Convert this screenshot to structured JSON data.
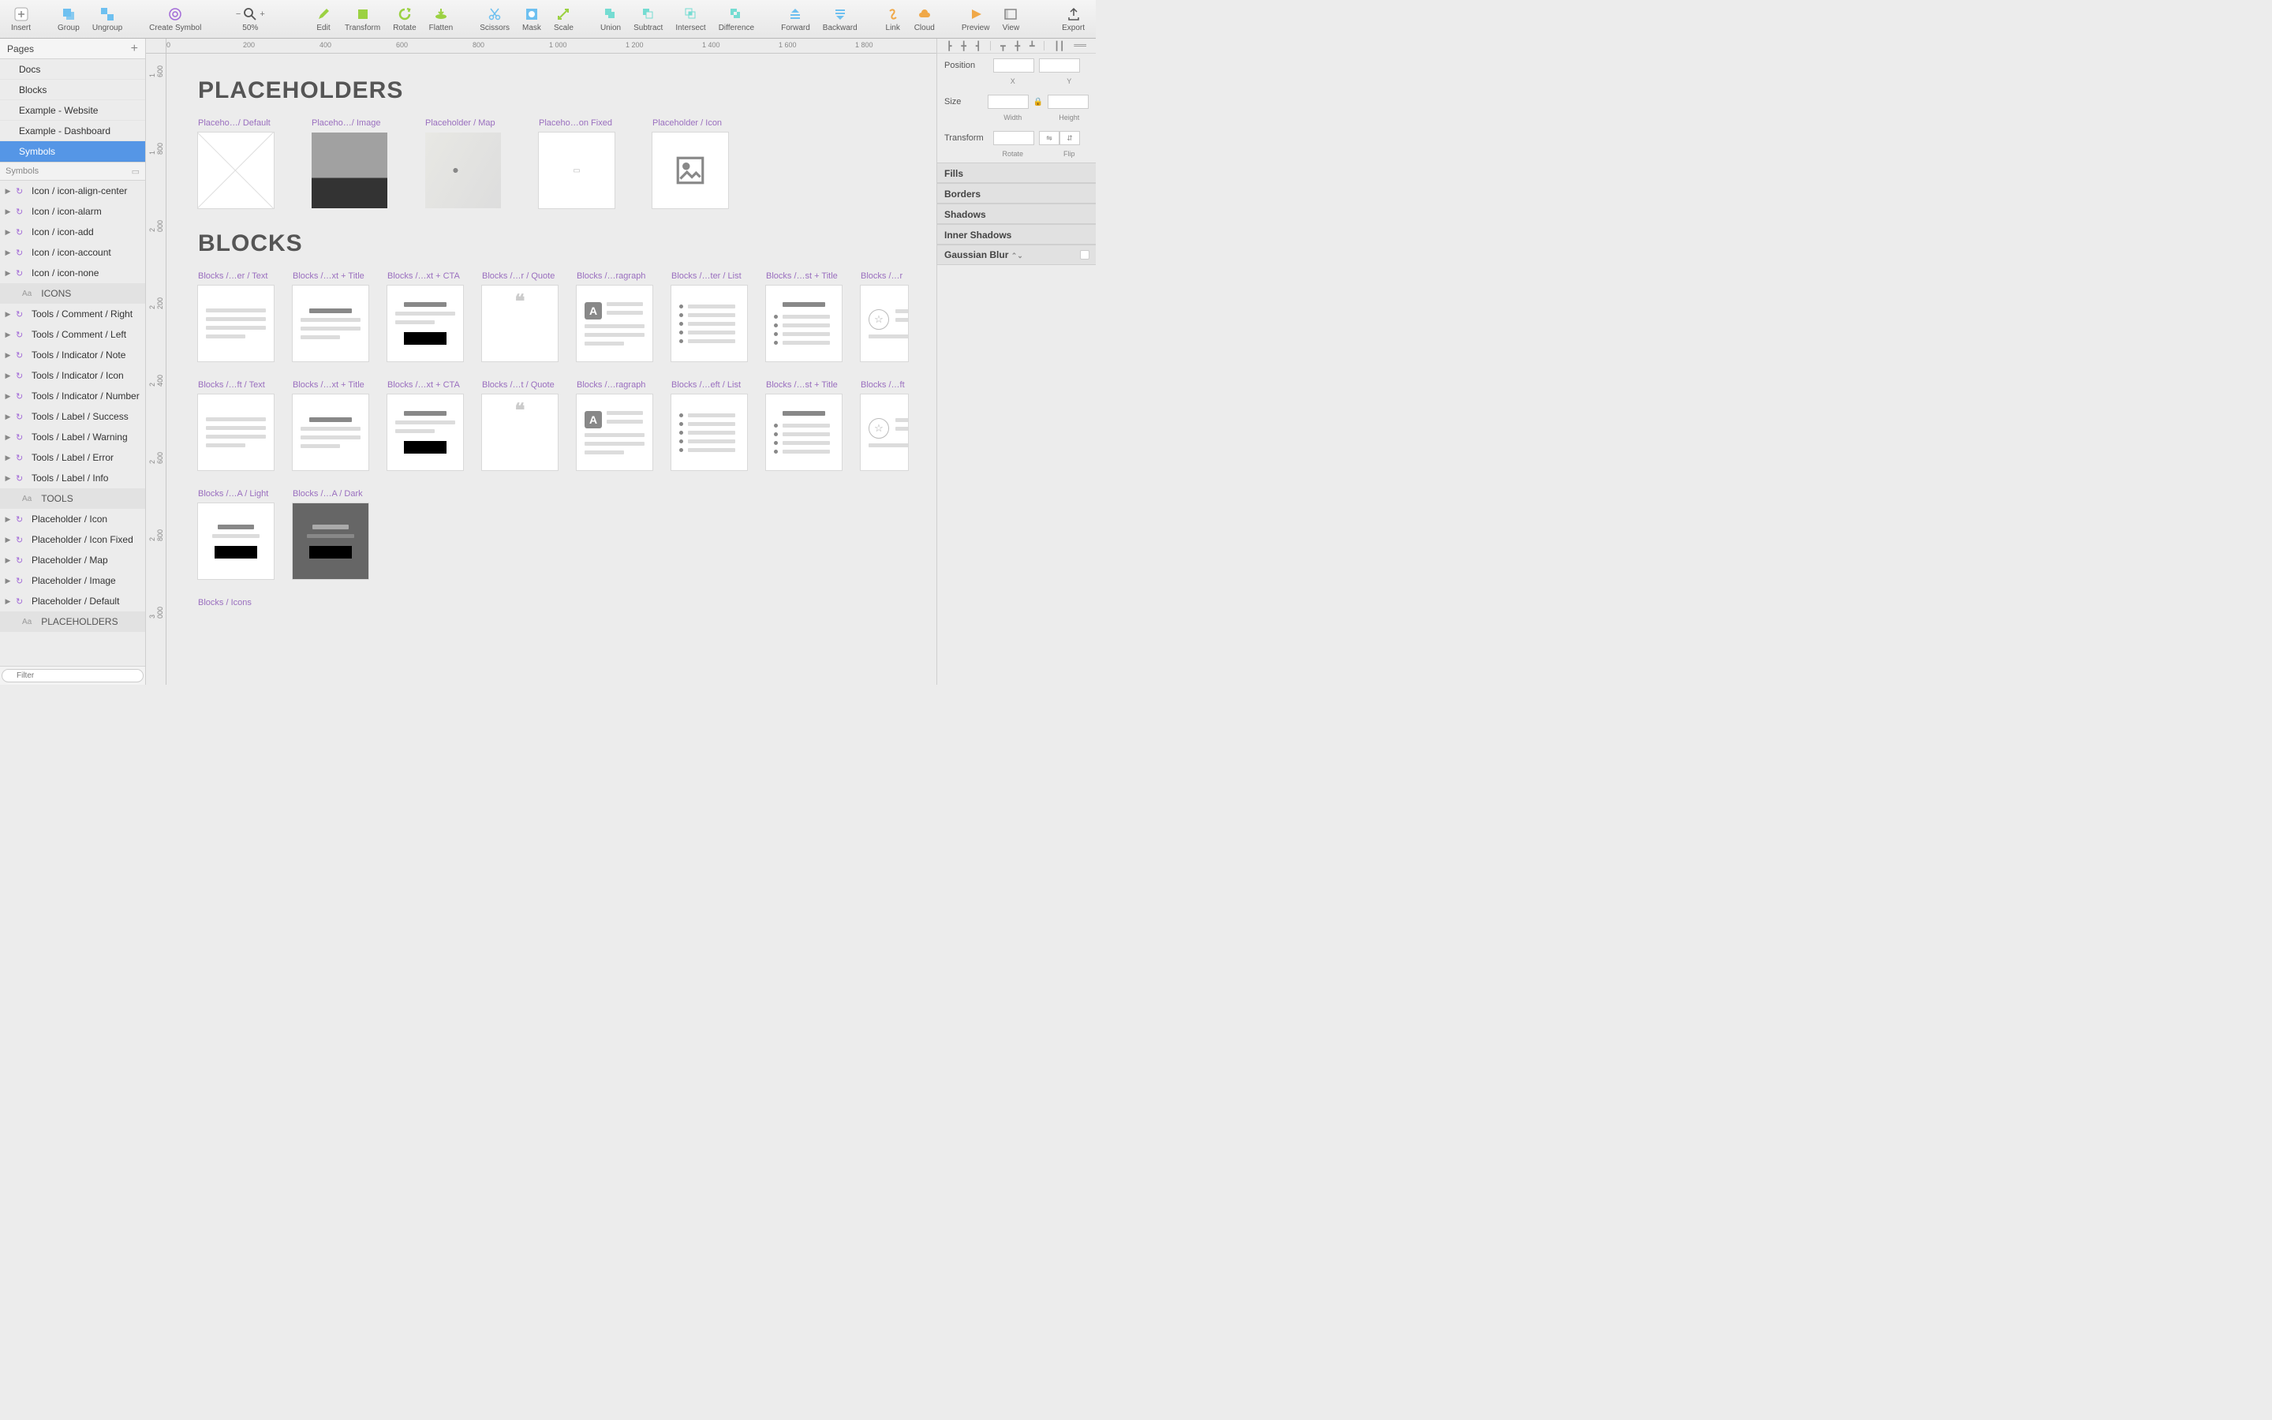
{
  "toolbar": {
    "insert": "Insert",
    "group": "Group",
    "ungroup": "Ungroup",
    "createSymbol": "Create Symbol",
    "zoom": "50%",
    "edit": "Edit",
    "transform": "Transform",
    "rotate": "Rotate",
    "flatten": "Flatten",
    "scissors": "Scissors",
    "mask": "Mask",
    "scale": "Scale",
    "union": "Union",
    "subtract": "Subtract",
    "intersect": "Intersect",
    "difference": "Difference",
    "forward": "Forward",
    "backward": "Backward",
    "link": "Link",
    "cloud": "Cloud",
    "preview": "Preview",
    "view": "View",
    "export": "Export"
  },
  "left": {
    "pagesTitle": "Pages",
    "pages": [
      "Docs",
      "Blocks",
      "Example - Website",
      "Example - Dashboard",
      "Symbols"
    ],
    "selectedPage": 4,
    "symbolsTitle": "Symbols",
    "layers": [
      {
        "t": "sym",
        "label": "Icon / icon-align-center"
      },
      {
        "t": "sym",
        "label": "Icon / icon-alarm"
      },
      {
        "t": "sym",
        "label": "Icon / icon-add"
      },
      {
        "t": "sym",
        "label": "Icon / icon-account"
      },
      {
        "t": "sym",
        "label": "Icon / icon-none"
      },
      {
        "t": "hdr",
        "label": "ICONS"
      },
      {
        "t": "sym",
        "label": "Tools / Comment / Right"
      },
      {
        "t": "sym",
        "label": "Tools / Comment / Left"
      },
      {
        "t": "sym",
        "label": "Tools / Indicator / Note"
      },
      {
        "t": "sym",
        "label": "Tools / Indicator / Icon"
      },
      {
        "t": "sym",
        "label": "Tools / Indicator / Number"
      },
      {
        "t": "sym",
        "label": "Tools / Label / Success"
      },
      {
        "t": "sym",
        "label": "Tools / Label / Warning"
      },
      {
        "t": "sym",
        "label": "Tools / Label / Error"
      },
      {
        "t": "sym",
        "label": "Tools / Label / Info"
      },
      {
        "t": "hdr",
        "label": "TOOLS"
      },
      {
        "t": "sym",
        "label": "Placeholder / Icon"
      },
      {
        "t": "sym",
        "label": "Placeholder / Icon Fixed"
      },
      {
        "t": "sym",
        "label": "Placeholder / Map"
      },
      {
        "t": "sym",
        "label": "Placeholder / Image"
      },
      {
        "t": "sym",
        "label": "Placeholder / Default"
      },
      {
        "t": "hdr",
        "label": "PLACEHOLDERS"
      }
    ],
    "filterPlaceholder": "Filter"
  },
  "ruler": {
    "h": [
      "0",
      "200",
      "400",
      "600",
      "800",
      "1 000",
      "1 200",
      "1 400",
      "1 600",
      "1 800"
    ],
    "v": [
      "1 600",
      "1 800",
      "2 000",
      "2 200",
      "2 400",
      "2 600",
      "2 800",
      "3 000"
    ]
  },
  "canvas": {
    "h1a": "PLACEHOLDERS",
    "h1b": "BLOCKS",
    "placeholders": [
      "Placeho…/ Default",
      "Placeho…/ Image",
      "Placeholder / Map",
      "Placeho…on Fixed",
      "Placeholder / Icon"
    ],
    "blocksRow1": [
      "Blocks /…er / Text",
      "Blocks /…xt + Title",
      "Blocks /…xt + CTA",
      "Blocks /…r / Quote",
      "Blocks /…ragraph",
      "Blocks /…ter / List",
      "Blocks /…st + Title",
      "Blocks /…r"
    ],
    "blocksRow2": [
      "Blocks /…ft / Text",
      "Blocks /…xt + Title",
      "Blocks /…xt + CTA",
      "Blocks /…t / Quote",
      "Blocks /…ragraph",
      "Blocks /…eft / List",
      "Blocks /…st + Title",
      "Blocks /…ft"
    ],
    "blocksRow3": [
      "Blocks /…A / Light",
      "Blocks /…A / Dark"
    ],
    "lastLabel": "Blocks / Icons"
  },
  "right": {
    "position": "Position",
    "x": "X",
    "y": "Y",
    "size": "Size",
    "width": "Width",
    "height": "Height",
    "transform": "Transform",
    "rotate": "Rotate",
    "flip": "Flip",
    "fills": "Fills",
    "borders": "Borders",
    "shadows": "Shadows",
    "inner": "Inner Shadows",
    "blur": "Gaussian Blur"
  }
}
